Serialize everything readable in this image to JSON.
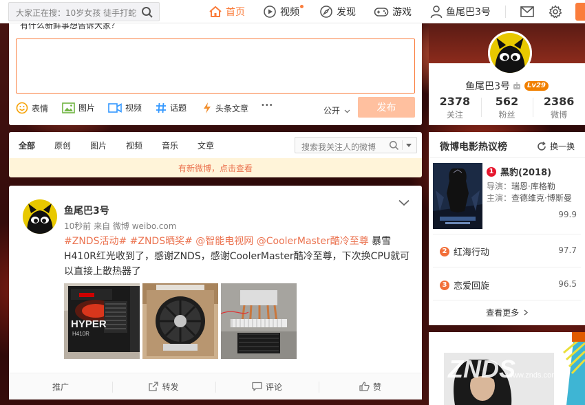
{
  "search": {
    "placeholder": "大家正在搜：10岁女孩 徒手打蛇"
  },
  "nav": {
    "home": "首页",
    "video": "视频",
    "discover": "发现",
    "game": "游戏",
    "username": "鱼尾巴3号"
  },
  "composer": {
    "hint": "有什么新鲜事想告诉大家？",
    "tools": {
      "emoji": "表情",
      "image": "图片",
      "video": "视频",
      "topic": "话题",
      "article": "头条文章",
      "more": "•••"
    },
    "visibility": "公开",
    "publish": "发布"
  },
  "feed_tabs": {
    "all": "全部",
    "original": "原创",
    "images": "图片",
    "video": "视频",
    "music": "音乐",
    "article": "文章",
    "search_placeholder": "搜索我关注人的微博"
  },
  "new_weibo_bar": "有新微博，点击查看",
  "post": {
    "author": "鱼尾巴3号",
    "meta": "10秒前 来自 微博 weibo.com",
    "tags": "#ZNDS活动# #ZNDS晒奖# @智能电视网 @CoolerMaster酷冷至尊",
    "text": " 暴雪H410R红光收到了，感谢ZNDS，感谢CoolerMaster酷冷至尊，下次换CPU就可以直接上散热器了",
    "image1_brand": "HYPER",
    "image1_model": "H410R",
    "actions": {
      "promote": "推广",
      "repost": "转发",
      "comment": "评论",
      "like": "赞"
    }
  },
  "profile": {
    "name": "鱼尾巴3号",
    "level": "Lv29",
    "following": "2378",
    "following_label": "关注",
    "fans": "562",
    "fans_label": "粉丝",
    "weibo": "2386",
    "weibo_label": "微博"
  },
  "movies": {
    "title": "微博电影热议榜",
    "refresh": "换一换",
    "top": {
      "rank": "1",
      "name": "黑豹(2018)",
      "director_label": "导演：",
      "director": "瑞恩·库格勒",
      "cast_label": "主演：",
      "cast": "查德维克·博斯曼",
      "score": "99.9"
    },
    "items": [
      {
        "rank": "2",
        "name": "红海行动",
        "score": "97.7"
      },
      {
        "rank": "3",
        "name": "恋爱回旋",
        "score": "96.5"
      }
    ],
    "more": "查看更多"
  },
  "ad": {
    "text": "ZNDS",
    "sub": "www.znds.com"
  },
  "colors": {
    "accent": "#fa7d3c",
    "link": "#eb7350",
    "level": "#f18000"
  }
}
